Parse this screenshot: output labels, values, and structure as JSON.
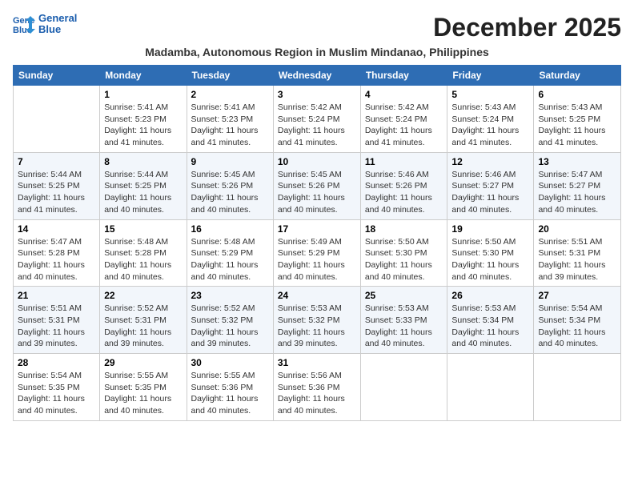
{
  "header": {
    "logo_line1": "General",
    "logo_line2": "Blue",
    "month_title": "December 2025",
    "subtitle": "Madamba, Autonomous Region in Muslim Mindanao, Philippines"
  },
  "days_of_week": [
    "Sunday",
    "Monday",
    "Tuesday",
    "Wednesday",
    "Thursday",
    "Friday",
    "Saturday"
  ],
  "weeks": [
    [
      {
        "num": "",
        "sunrise": "",
        "sunset": "",
        "daylight": ""
      },
      {
        "num": "1",
        "sunrise": "Sunrise: 5:41 AM",
        "sunset": "Sunset: 5:23 PM",
        "daylight": "Daylight: 11 hours and 41 minutes."
      },
      {
        "num": "2",
        "sunrise": "Sunrise: 5:41 AM",
        "sunset": "Sunset: 5:23 PM",
        "daylight": "Daylight: 11 hours and 41 minutes."
      },
      {
        "num": "3",
        "sunrise": "Sunrise: 5:42 AM",
        "sunset": "Sunset: 5:24 PM",
        "daylight": "Daylight: 11 hours and 41 minutes."
      },
      {
        "num": "4",
        "sunrise": "Sunrise: 5:42 AM",
        "sunset": "Sunset: 5:24 PM",
        "daylight": "Daylight: 11 hours and 41 minutes."
      },
      {
        "num": "5",
        "sunrise": "Sunrise: 5:43 AM",
        "sunset": "Sunset: 5:24 PM",
        "daylight": "Daylight: 11 hours and 41 minutes."
      },
      {
        "num": "6",
        "sunrise": "Sunrise: 5:43 AM",
        "sunset": "Sunset: 5:25 PM",
        "daylight": "Daylight: 11 hours and 41 minutes."
      }
    ],
    [
      {
        "num": "7",
        "sunrise": "Sunrise: 5:44 AM",
        "sunset": "Sunset: 5:25 PM",
        "daylight": "Daylight: 11 hours and 41 minutes."
      },
      {
        "num": "8",
        "sunrise": "Sunrise: 5:44 AM",
        "sunset": "Sunset: 5:25 PM",
        "daylight": "Daylight: 11 hours and 40 minutes."
      },
      {
        "num": "9",
        "sunrise": "Sunrise: 5:45 AM",
        "sunset": "Sunset: 5:26 PM",
        "daylight": "Daylight: 11 hours and 40 minutes."
      },
      {
        "num": "10",
        "sunrise": "Sunrise: 5:45 AM",
        "sunset": "Sunset: 5:26 PM",
        "daylight": "Daylight: 11 hours and 40 minutes."
      },
      {
        "num": "11",
        "sunrise": "Sunrise: 5:46 AM",
        "sunset": "Sunset: 5:26 PM",
        "daylight": "Daylight: 11 hours and 40 minutes."
      },
      {
        "num": "12",
        "sunrise": "Sunrise: 5:46 AM",
        "sunset": "Sunset: 5:27 PM",
        "daylight": "Daylight: 11 hours and 40 minutes."
      },
      {
        "num": "13",
        "sunrise": "Sunrise: 5:47 AM",
        "sunset": "Sunset: 5:27 PM",
        "daylight": "Daylight: 11 hours and 40 minutes."
      }
    ],
    [
      {
        "num": "14",
        "sunrise": "Sunrise: 5:47 AM",
        "sunset": "Sunset: 5:28 PM",
        "daylight": "Daylight: 11 hours and 40 minutes."
      },
      {
        "num": "15",
        "sunrise": "Sunrise: 5:48 AM",
        "sunset": "Sunset: 5:28 PM",
        "daylight": "Daylight: 11 hours and 40 minutes."
      },
      {
        "num": "16",
        "sunrise": "Sunrise: 5:48 AM",
        "sunset": "Sunset: 5:29 PM",
        "daylight": "Daylight: 11 hours and 40 minutes."
      },
      {
        "num": "17",
        "sunrise": "Sunrise: 5:49 AM",
        "sunset": "Sunset: 5:29 PM",
        "daylight": "Daylight: 11 hours and 40 minutes."
      },
      {
        "num": "18",
        "sunrise": "Sunrise: 5:50 AM",
        "sunset": "Sunset: 5:30 PM",
        "daylight": "Daylight: 11 hours and 40 minutes."
      },
      {
        "num": "19",
        "sunrise": "Sunrise: 5:50 AM",
        "sunset": "Sunset: 5:30 PM",
        "daylight": "Daylight: 11 hours and 40 minutes."
      },
      {
        "num": "20",
        "sunrise": "Sunrise: 5:51 AM",
        "sunset": "Sunset: 5:31 PM",
        "daylight": "Daylight: 11 hours and 39 minutes."
      }
    ],
    [
      {
        "num": "21",
        "sunrise": "Sunrise: 5:51 AM",
        "sunset": "Sunset: 5:31 PM",
        "daylight": "Daylight: 11 hours and 39 minutes."
      },
      {
        "num": "22",
        "sunrise": "Sunrise: 5:52 AM",
        "sunset": "Sunset: 5:31 PM",
        "daylight": "Daylight: 11 hours and 39 minutes."
      },
      {
        "num": "23",
        "sunrise": "Sunrise: 5:52 AM",
        "sunset": "Sunset: 5:32 PM",
        "daylight": "Daylight: 11 hours and 39 minutes."
      },
      {
        "num": "24",
        "sunrise": "Sunrise: 5:53 AM",
        "sunset": "Sunset: 5:32 PM",
        "daylight": "Daylight: 11 hours and 39 minutes."
      },
      {
        "num": "25",
        "sunrise": "Sunrise: 5:53 AM",
        "sunset": "Sunset: 5:33 PM",
        "daylight": "Daylight: 11 hours and 40 minutes."
      },
      {
        "num": "26",
        "sunrise": "Sunrise: 5:53 AM",
        "sunset": "Sunset: 5:34 PM",
        "daylight": "Daylight: 11 hours and 40 minutes."
      },
      {
        "num": "27",
        "sunrise": "Sunrise: 5:54 AM",
        "sunset": "Sunset: 5:34 PM",
        "daylight": "Daylight: 11 hours and 40 minutes."
      }
    ],
    [
      {
        "num": "28",
        "sunrise": "Sunrise: 5:54 AM",
        "sunset": "Sunset: 5:35 PM",
        "daylight": "Daylight: 11 hours and 40 minutes."
      },
      {
        "num": "29",
        "sunrise": "Sunrise: 5:55 AM",
        "sunset": "Sunset: 5:35 PM",
        "daylight": "Daylight: 11 hours and 40 minutes."
      },
      {
        "num": "30",
        "sunrise": "Sunrise: 5:55 AM",
        "sunset": "Sunset: 5:36 PM",
        "daylight": "Daylight: 11 hours and 40 minutes."
      },
      {
        "num": "31",
        "sunrise": "Sunrise: 5:56 AM",
        "sunset": "Sunset: 5:36 PM",
        "daylight": "Daylight: 11 hours and 40 minutes."
      },
      {
        "num": "",
        "sunrise": "",
        "sunset": "",
        "daylight": ""
      },
      {
        "num": "",
        "sunrise": "",
        "sunset": "",
        "daylight": ""
      },
      {
        "num": "",
        "sunrise": "",
        "sunset": "",
        "daylight": ""
      }
    ]
  ]
}
